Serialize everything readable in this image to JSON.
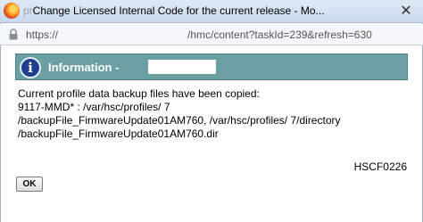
{
  "window": {
    "title_prefix": "pr",
    "title": "Change Licensed Internal Code for the current release - Mo...",
    "close_glyph": "✕"
  },
  "urlbar": {
    "scheme": "https://",
    "path": "/hmc/content?taskId=239&refresh=630"
  },
  "dialog": {
    "header": "Information -",
    "message_lines": [
      "Current profile data backup files have been copied:",
      "9117-MMD*            : /var/hsc/profiles/           7",
      "/backupFile_FirmwareUpdate01AM760, /var/hsc/profiles/              7/directory",
      "/backupFile_FirmwareUpdate01AM760.dir"
    ],
    "code": "HSCF0226",
    "ok_label": "OK"
  },
  "icons": {
    "browser": "firefox-icon",
    "lock": "lock-icon",
    "info": "info-icon"
  }
}
